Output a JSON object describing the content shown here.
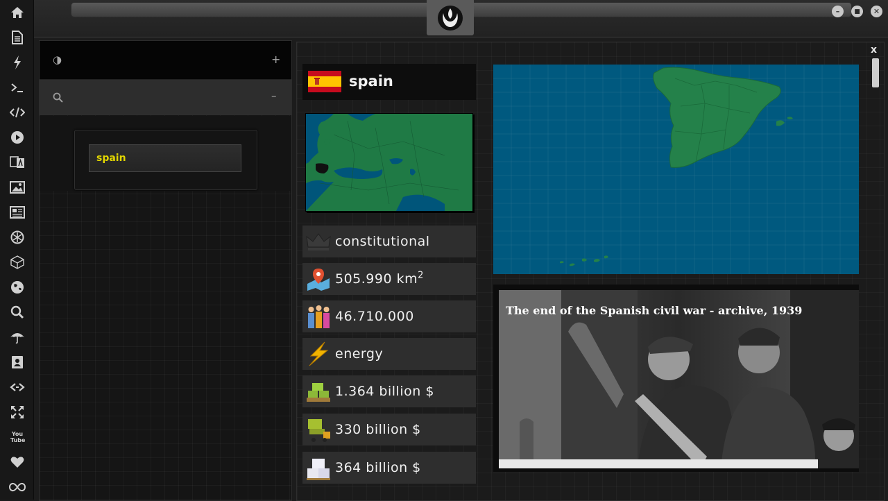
{
  "sidebar": {
    "icons": [
      "home-icon",
      "document-icon",
      "lightning-icon",
      "terminal-icon",
      "code-icon",
      "play-icon",
      "translate-icon",
      "image-icon",
      "news-icon",
      "rebel-icon",
      "polyhedron-icon",
      "globe-icon",
      "search-icon",
      "umbrella-icon",
      "contact-icon",
      "link-icon",
      "expand-icon",
      "youtube-icon",
      "heart-icon",
      "infinity-icon"
    ],
    "youtube_label": "You Tube"
  },
  "window": {
    "minimize": "–",
    "maximize": "■",
    "close": "✕"
  },
  "left_panel": {
    "contrast_glyph": "◑",
    "add_glyph": "+",
    "search_glyph": "⚲",
    "collapse_glyph": "–",
    "search_value": "spain"
  },
  "main": {
    "close_label": "x",
    "country": "spain",
    "rows": {
      "government": "constitutional",
      "area": "505.990 km",
      "area_sup": "2",
      "population": "46.710.000",
      "industry": "energy",
      "gdp": "1.364 billion $",
      "exports": "330 billion $",
      "imports": "364 billion $"
    },
    "photo_caption": "The end of the Spanish civil war - archive, 1939"
  },
  "colors": {
    "accent_yellow": "#e2d600",
    "sea": "#00597f",
    "land": "#24814a"
  }
}
